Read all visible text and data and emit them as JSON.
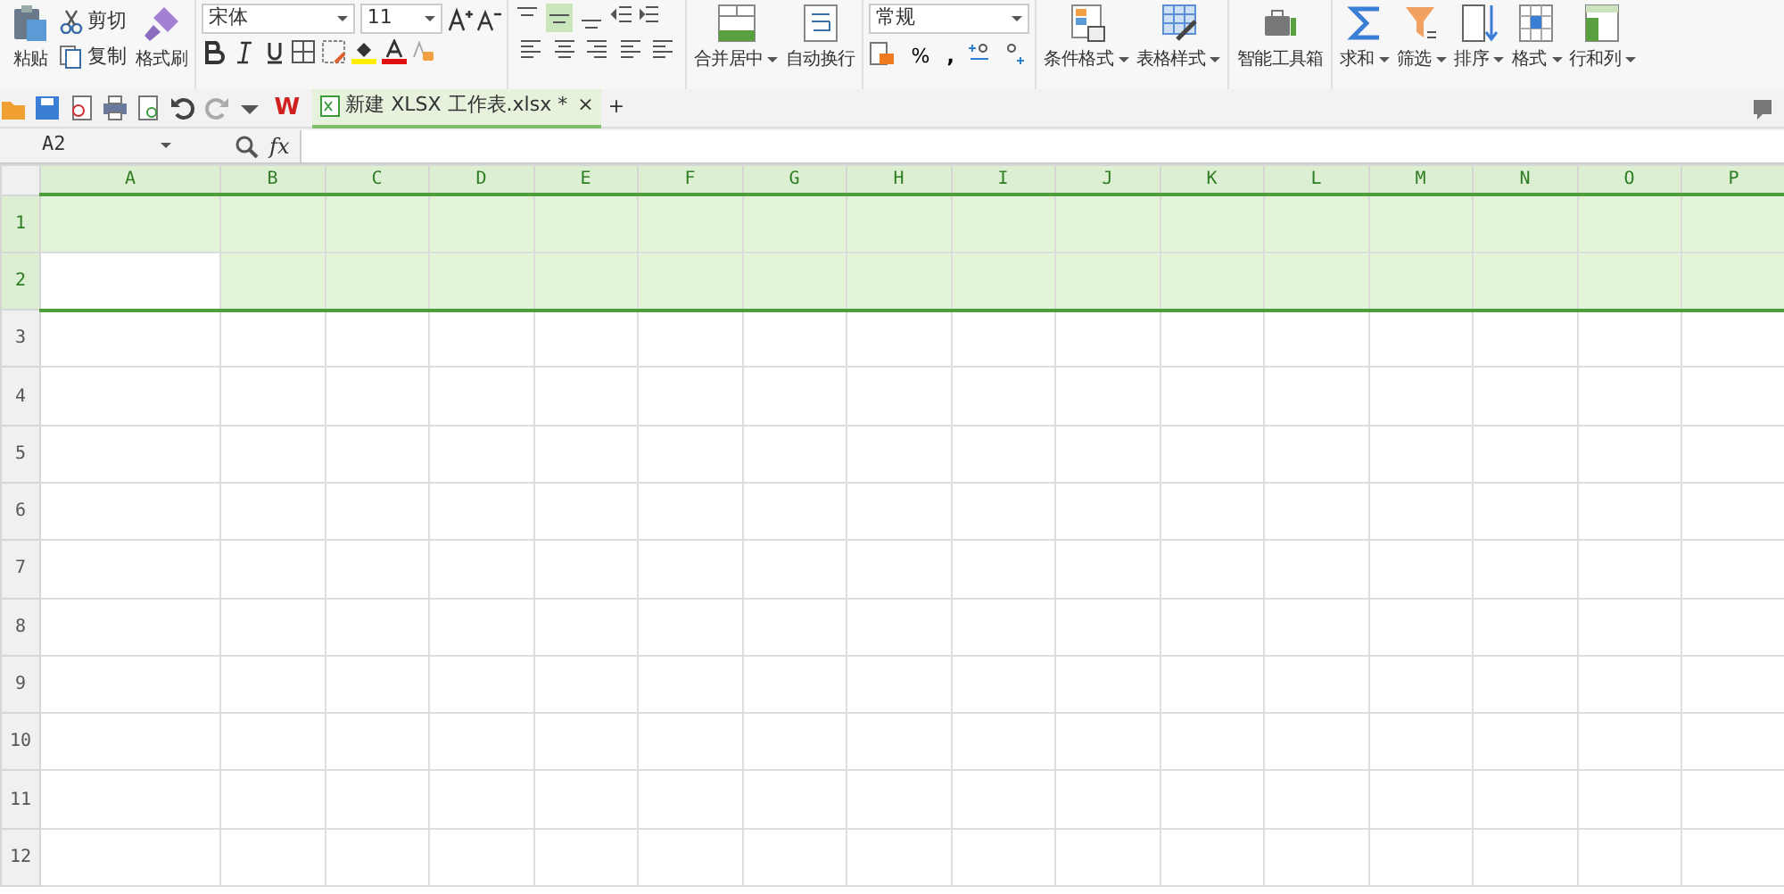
{
  "ribbon": {
    "clipboard": {
      "paste": "粘贴",
      "cut": "剪切",
      "copy": "复制",
      "format_painter": "格式刷"
    },
    "font": {
      "name": "宋体",
      "size": "11"
    },
    "alignment": {
      "top_row": [
        {
          "selected": false
        },
        {
          "selected": true
        },
        {
          "selected": false
        }
      ]
    },
    "merge": [
      {
        "label": "合并居中",
        "dropdown": true
      },
      {
        "label": "自动换行",
        "dropdown": false
      }
    ],
    "number": {
      "format": "常规",
      "percent": "%",
      "thousands": ","
    },
    "tools": [
      {
        "label": "条件格式",
        "dropdown": true
      },
      {
        "label": "表格样式",
        "dropdown": true
      },
      {
        "label": "智能工具箱",
        "dropdown": false
      },
      {
        "label": "求和",
        "dropdown": true
      },
      {
        "label": "筛选",
        "dropdown": true
      },
      {
        "label": "排序",
        "dropdown": true
      },
      {
        "label": "格式",
        "dropdown": true
      },
      {
        "label": "行和列",
        "dropdown": true
      }
    ]
  },
  "tab_bar": {
    "app_logo": "W",
    "tab": {
      "title": "新建 XLSX 工作表.xlsx *",
      "close": "×"
    },
    "new_tab": "+"
  },
  "formula_bar": {
    "name_box": "A2",
    "fx": "fx"
  },
  "grid": {
    "columns": [
      {
        "label": "A",
        "active": true
      },
      {
        "label": "B",
        "active": false
      },
      {
        "label": "C",
        "active": false
      },
      {
        "label": "D",
        "active": false
      },
      {
        "label": "E",
        "active": false
      },
      {
        "label": "F",
        "active": false
      },
      {
        "label": "G",
        "active": false
      },
      {
        "label": "H",
        "active": false
      },
      {
        "label": "I",
        "active": false
      },
      {
        "label": "J",
        "active": false
      },
      {
        "label": "K",
        "active": false
      },
      {
        "label": "L",
        "active": false
      },
      {
        "label": "M",
        "active": false
      },
      {
        "label": "N",
        "active": false
      },
      {
        "label": "O",
        "active": false
      },
      {
        "label": "P",
        "active": false
      }
    ],
    "rows": [
      {
        "label": "1",
        "selected": true,
        "active": false
      },
      {
        "label": "2",
        "selected": true,
        "active": true
      },
      {
        "label": "3",
        "selected": false,
        "active": false
      },
      {
        "label": "4",
        "selected": false,
        "active": false
      },
      {
        "label": "5",
        "selected": false,
        "active": false
      },
      {
        "label": "6",
        "selected": false,
        "active": false
      },
      {
        "label": "7",
        "selected": false,
        "active": false
      },
      {
        "label": "8",
        "selected": false,
        "active": false
      },
      {
        "label": "9",
        "selected": false,
        "active": false
      },
      {
        "label": "10",
        "selected": false,
        "active": false
      },
      {
        "label": "11",
        "selected": false,
        "active": false
      },
      {
        "label": "12",
        "selected": false,
        "active": false
      }
    ]
  }
}
